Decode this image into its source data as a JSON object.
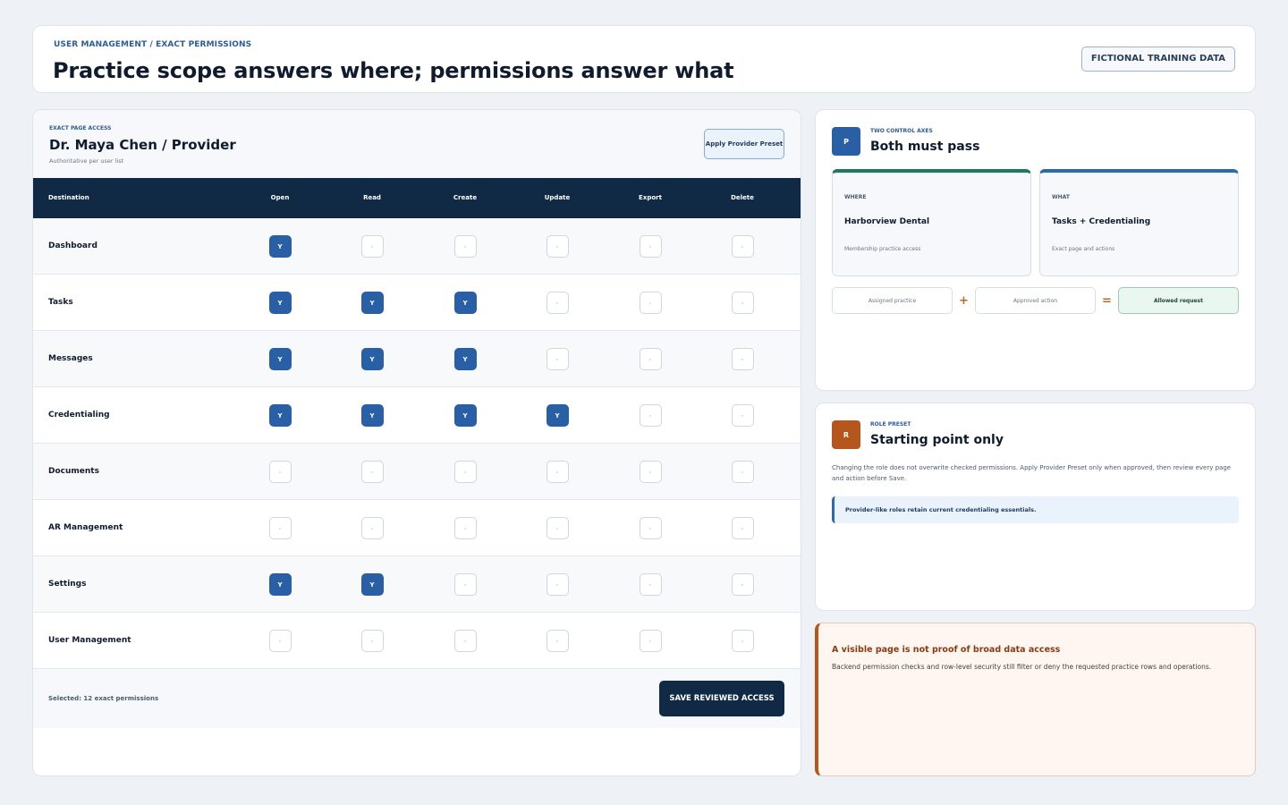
{
  "header": {
    "breadcrumb": "USER MANAGEMENT / EXACT PERMISSIONS",
    "title": "Practice scope answers where; permissions answer what",
    "badge": "FICTIONAL TRAINING DATA"
  },
  "access": {
    "eyebrow": "EXACT PAGE ACCESS",
    "user": "Dr. Maya Chen / Provider",
    "subtitle": "Authoritative per user list",
    "preset_button": "Apply Provider Preset",
    "columns": [
      "Destination",
      "Open",
      "Read",
      "Create",
      "Update",
      "Export",
      "Delete"
    ],
    "rows": [
      {
        "label": "Dashboard",
        "cells": [
          "Y",
          "-",
          "-",
          "-",
          "-",
          "-"
        ]
      },
      {
        "label": "Tasks",
        "cells": [
          "Y",
          "Y",
          "Y",
          "-",
          "-",
          "-"
        ]
      },
      {
        "label": "Messages",
        "cells": [
          "Y",
          "Y",
          "Y",
          "-",
          "-",
          "-"
        ]
      },
      {
        "label": "Credentialing",
        "cells": [
          "Y",
          "Y",
          "Y",
          "Y",
          "-",
          "-"
        ]
      },
      {
        "label": "Documents",
        "cells": [
          "-",
          "-",
          "-",
          "-",
          "-",
          "-"
        ]
      },
      {
        "label": "AR Management",
        "cells": [
          "-",
          "-",
          "-",
          "-",
          "-",
          "-"
        ]
      },
      {
        "label": "Settings",
        "cells": [
          "Y",
          "Y",
          "-",
          "-",
          "-",
          "-"
        ]
      },
      {
        "label": "User Management",
        "cells": [
          "-",
          "-",
          "-",
          "-",
          "-",
          "-"
        ]
      }
    ],
    "selected_text": "Selected: 12 exact permissions",
    "save_button": "SAVE REVIEWED ACCESS"
  },
  "axes_card": {
    "icon_letter": "P",
    "eyebrow": "TWO CONTROL AXES",
    "title": "Both must pass",
    "where": {
      "label": "WHERE",
      "value": "Harborview Dental",
      "note": "Membership practice access"
    },
    "what": {
      "label": "WHAT",
      "value": "Tasks + Credentialing",
      "note": "Exact page and actions"
    },
    "equation": {
      "a": "Assigned practice",
      "plus": "+",
      "b": "Approved action",
      "equals": "=",
      "result": "Allowed request"
    }
  },
  "preset_card": {
    "icon_letter": "R",
    "eyebrow": "ROLE PRESET",
    "title": "Starting point only",
    "text": "Changing the role does not overwrite checked permissions. Apply Provider Preset only when approved, then review every page and action before Save.",
    "note": "Provider-like roles retain current credentialing essentials."
  },
  "warning": {
    "title": "A visible page is not proof of broad data access",
    "body": "Backend permission checks and row-level security still filter or deny the requested practice rows and operations."
  },
  "colors": {
    "accent": "#285fa5",
    "navy": "#102a45",
    "where": "#1f7a5a",
    "warn": "#b5571d"
  }
}
